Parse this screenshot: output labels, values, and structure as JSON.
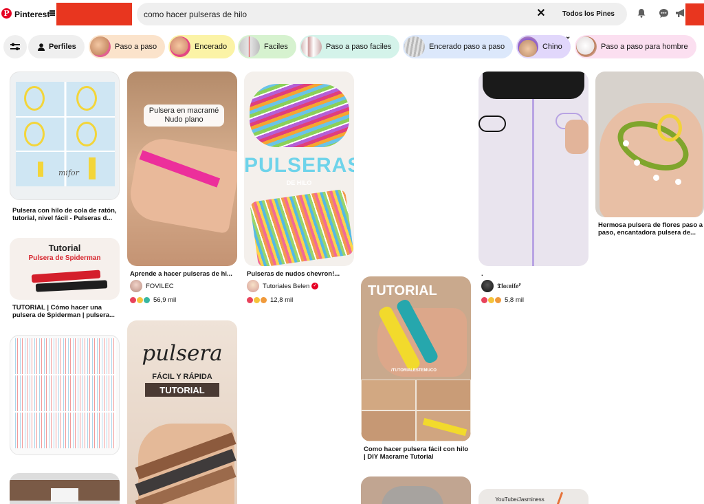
{
  "header": {
    "brand": "Pinterest",
    "search_value": "como hacer pulseras de hilo",
    "scope_label": "Todos los Pines"
  },
  "pills": [
    {
      "label": "Perfiles"
    },
    {
      "label": "Paso a paso",
      "color": "#fbe3cb"
    },
    {
      "label": "Encerado",
      "color": "#fbf3a6"
    },
    {
      "label": "Faciles",
      "color": "#d6f2cf"
    },
    {
      "label": "Paso a paso faciles",
      "color": "#d4f3ea"
    },
    {
      "label": "Encerado paso a paso",
      "color": "#dce8fb"
    },
    {
      "label": "Chino",
      "color": "#e1d7fb"
    },
    {
      "label": "Paso a paso para hombre",
      "color": "#fbdff0"
    }
  ],
  "pins": [
    {
      "title": "Pulsera con hilo de cola de ratón, tutorial, nivel fácil - Pulseras d...",
      "image_text": "mifor"
    },
    {
      "title": "TUTORIAL | Cómo hacer una pulsera de Spiderman | pulsera...",
      "image_text_1": "Tutorial",
      "image_text_2": "Pulsera de Spiderman"
    },
    {
      "title": "",
      "image_text": ""
    },
    {
      "title": "Aprende a hacer pulseras de hi...",
      "author": "FOVILEC",
      "reactions": "56,9 mil",
      "image_text": "Pulsera en macramé Nudo plano"
    },
    {
      "title": "",
      "image_text_1": "pulsera",
      "image_text_2": "FÁCIL Y RÁPIDA",
      "image_text_3": "TUTORIAL"
    },
    {
      "title": "Pulseras de nudos chevron!...",
      "author": "Tutoriales Belen",
      "reactions": "12,8 mil",
      "image_text_1": "PULSERAS",
      "image_text_2": "DE HILO"
    },
    {
      "title": "Como hacer pulsera fácil con hilo | DIY Macrame Tutorial",
      "image_text_1": "TUTORIAL",
      "image_text_2": "/TUTORIALESTEMUCO"
    },
    {
      "title": ".",
      "author": "𝕿𝖑𝖆𝖈𝖚𝖎𝖑𝖔ᴾ",
      "reactions": "5,8 mil"
    },
    {
      "title": "",
      "image_text": "YouTube/Jasminess"
    },
    {
      "title": "Hermosa pulsera de flores paso a paso, encantadora pulsera de..."
    }
  ],
  "colors": {
    "brand_red": "#e60023",
    "redaction": "#e8361f",
    "search_bg": "#efefef"
  },
  "icons": [
    "pinterest-logo-icon",
    "menu-icon",
    "clear-search-icon",
    "chevron-down-icon",
    "bell-icon",
    "chat-icon",
    "megaphone-icon",
    "filter-settings-icon",
    "person-icon"
  ]
}
